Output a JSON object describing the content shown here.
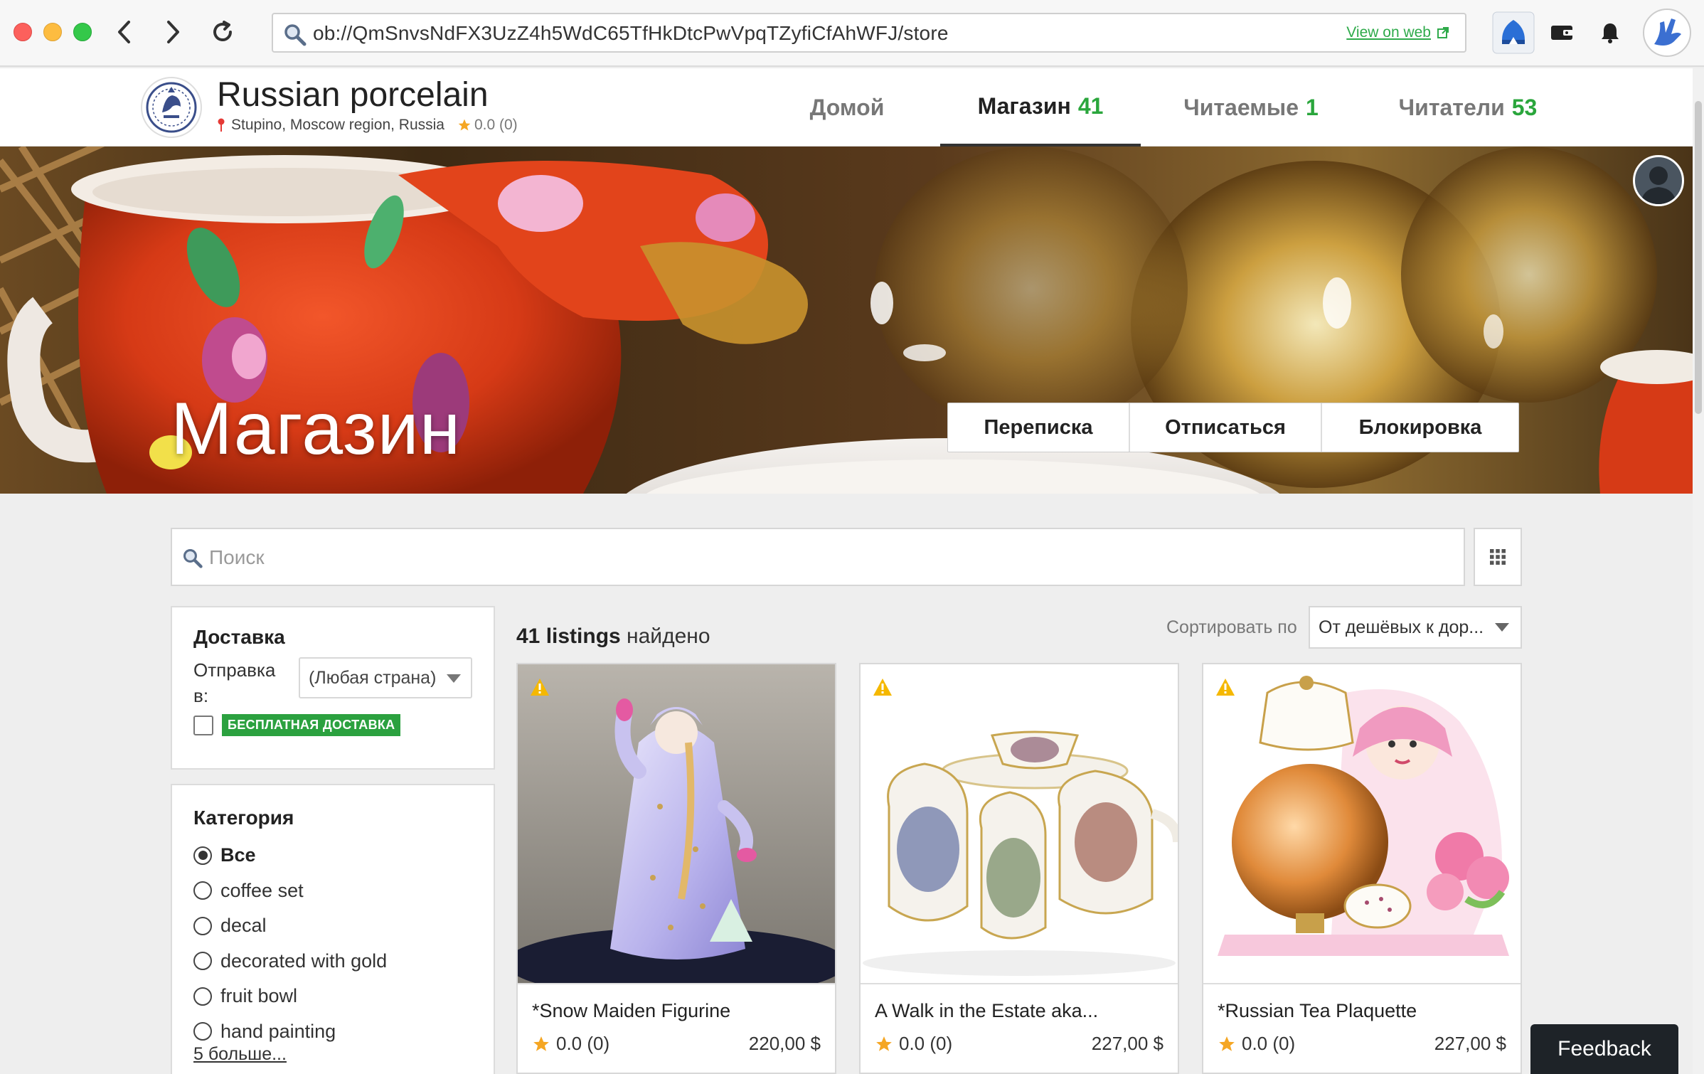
{
  "browser": {
    "url": "ob://QmSnvsNdFX3UzZ4h5WdC65TfHkDtcPwVpqTZyfiCfAhWFJ/store",
    "view_on_web": "View on web"
  },
  "store": {
    "name": "Russian porcelain",
    "location": "Stupino, Moscow region, Russia",
    "rating": "0.0 (0)"
  },
  "nav": {
    "tabs": [
      {
        "label": "Домой",
        "count": ""
      },
      {
        "label": "Магазин",
        "count": "41"
      },
      {
        "label": "Читаемые",
        "count": "1"
      },
      {
        "label": "Читатели",
        "count": "53"
      }
    ]
  },
  "hero": {
    "title": "Магазин",
    "actions": [
      "Переписка",
      "Отписаться",
      "Блокировка"
    ]
  },
  "search": {
    "placeholder": "Поиск"
  },
  "filters": {
    "delivery": {
      "title": "Доставка",
      "ship_to_label": "Отправка в:",
      "ship_to_value": "(Любая страна)",
      "free_shipping_badge": "БЕСПЛАТНАЯ ДОСТАВКА"
    },
    "category": {
      "title": "Категория",
      "items": [
        "Все",
        "coffee set",
        "decal",
        "decorated with gold",
        "fruit bowl",
        "hand painting"
      ],
      "more": "5 больше..."
    }
  },
  "results": {
    "count_bold": "41 listings",
    "count_suffix": " найдено",
    "sort_label": "Сортировать по",
    "sort_value": "От дешёвых к дор..."
  },
  "listings": [
    {
      "title": "*Snow Maiden Figurine",
      "rating": "0.0 (0)",
      "price": "220,00 $"
    },
    {
      "title": "A Walk in the Estate aka...",
      "rating": "0.0 (0)",
      "price": "227,00 $"
    },
    {
      "title": "*Russian Tea Plaquette",
      "rating": "0.0 (0)",
      "price": "227,00 $"
    }
  ],
  "feedback": "Feedback",
  "colors": {
    "accent_green": "#2aa63c",
    "hero_red": "#d9411c",
    "star": "#f5a623",
    "warning": "#f5b800"
  }
}
